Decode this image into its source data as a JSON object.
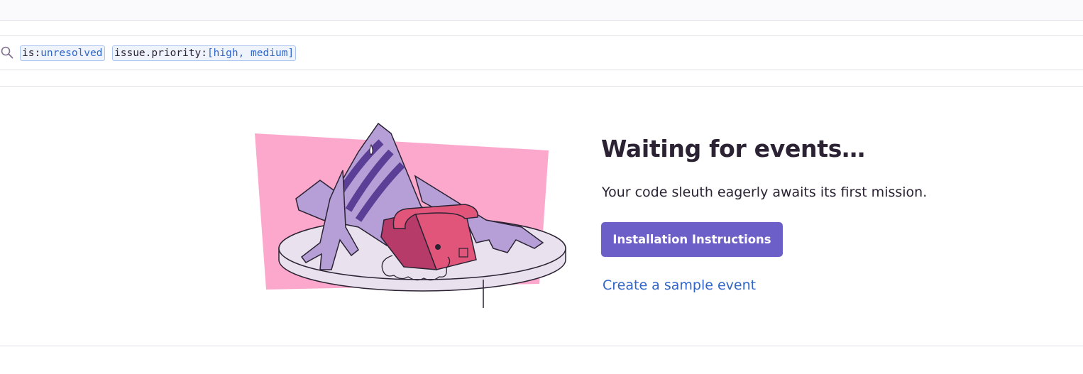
{
  "search": {
    "icon": "search-icon",
    "tokens": [
      {
        "key": "is:",
        "value": "unresolved"
      },
      {
        "key": "issue.priority:",
        "value": "[high, medium]"
      }
    ]
  },
  "empty_state": {
    "illustration": "waiting-sleuth-illustration",
    "title": "Waiting for events…",
    "description": "Your code sleuth eagerly awaits its first mission.",
    "primary_button": "Installation Instructions",
    "secondary_link": "Create a sample event"
  },
  "colors": {
    "accent": "#6c5fc7",
    "link": "#2f66c8",
    "text": "#2b2233",
    "token_border": "#a9c3ee",
    "token_bg": "#eef3fc",
    "illustration_pink": "#fca8cc",
    "illustration_purple": "#b59fd6",
    "illustration_phone": "#e1557a"
  }
}
